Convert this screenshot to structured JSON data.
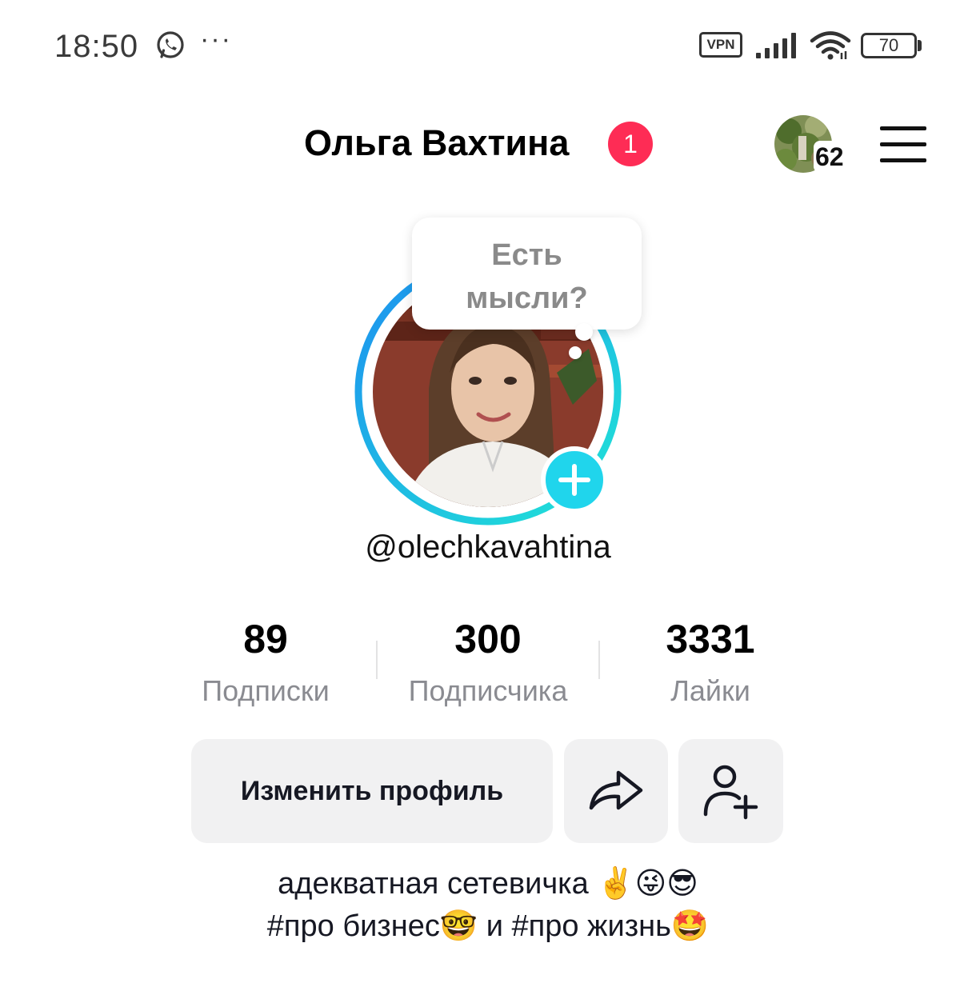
{
  "status_bar": {
    "time": "18:50",
    "more": "···",
    "vpn": "VPN",
    "battery": "70"
  },
  "header": {
    "name": "Ольга Вахтина",
    "notification_count": "1",
    "friends_count": "62"
  },
  "avatar": {
    "thought_line1": "Есть",
    "thought_line2": "мысли?"
  },
  "username": "@olechkavahtina",
  "stats": [
    {
      "value": "89",
      "label": "Подписки"
    },
    {
      "value": "300",
      "label": "Подписчика"
    },
    {
      "value": "3331",
      "label": "Лайки"
    }
  ],
  "buttons": {
    "edit_profile": "Изменить профиль"
  },
  "bio": {
    "line1": "адекватная сетевичка ✌️😜😎",
    "line2": "#про бизнес🤓 и #про жизнь🤩"
  },
  "colors": {
    "notification": "#fe2c55",
    "story_ring_start": "#1d8ff0",
    "story_ring_end": "#20e6d6",
    "add_story": "#20d5ec"
  }
}
